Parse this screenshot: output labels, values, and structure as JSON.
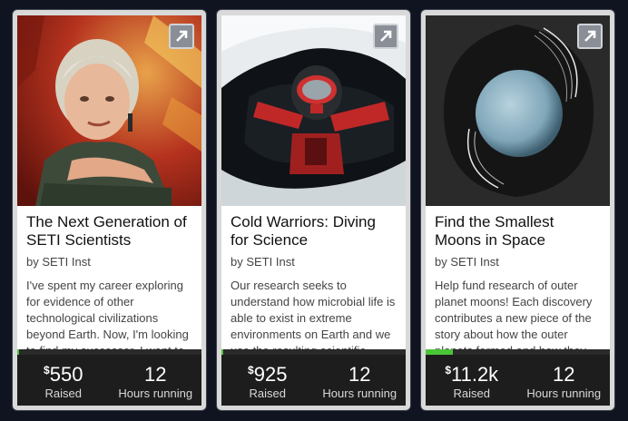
{
  "cards": [
    {
      "title": "The Next Generation of SETI Scientists",
      "byline": "by SETI Inst",
      "description": "I've spent my career exploring for evidence of other technological civilizations beyond Earth. Now, I'm looking to find my successor. I want to",
      "raised_currency": "$",
      "raised_amount": "550",
      "raised_label": "Raised",
      "hours": "12",
      "hours_label": "Hours running",
      "progress_fraction": 0.01,
      "image_icon": "woman-portrait-photo",
      "share_icon": "external-link-arrow-icon"
    },
    {
      "title": "Cold Warriors: Diving for Science",
      "byline": "by SETI Inst",
      "description": "Our research seeks to understand how microbial life is able to exist in extreme environments on Earth and we use the resulting scientific",
      "raised_currency": "$",
      "raised_amount": "925",
      "raised_label": "Raised",
      "hours": "12",
      "hours_label": "Hours running",
      "progress_fraction": 0.01,
      "image_icon": "ice-diver-photo",
      "share_icon": "external-link-arrow-icon"
    },
    {
      "title": "Find the Smallest Moons in Space",
      "byline": "by SETI Inst",
      "description": "Help fund research of outer planet moons! Each discovery contributes a new piece of the story about how the outer planets formed and how they",
      "raised_currency": "$",
      "raised_amount": "11.2k",
      "raised_label": "Raised",
      "hours": "12",
      "hours_label": "Hours running",
      "progress_fraction": 0.15,
      "image_icon": "uranus-planet-photo",
      "share_icon": "external-link-arrow-icon"
    }
  ],
  "colors": {
    "background": "#101420",
    "card_frame": "#d9d9d9",
    "stats_bar": "#1d1d1d",
    "progress_fill": "#4cc43a"
  }
}
